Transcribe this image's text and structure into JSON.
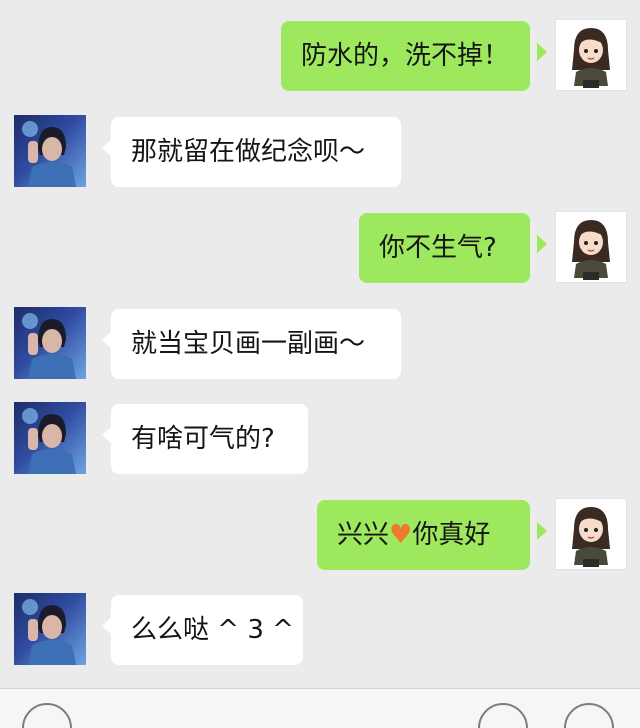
{
  "messages": [
    {
      "side": "out",
      "text": "防水的，洗不掉！"
    },
    {
      "side": "in",
      "text": "那就留在做纪念呗～"
    },
    {
      "side": "out",
      "text": "你不生气?"
    },
    {
      "side": "in",
      "text": "就当宝贝画一副画～"
    },
    {
      "side": "in",
      "text": "有啥可气的?"
    },
    {
      "side": "out",
      "text_before": "兴兴",
      "emoji": "♥",
      "text_after": "你真好"
    },
    {
      "side": "in",
      "text": "么么哒 ^ 3 ^"
    }
  ],
  "colors": {
    "background": "#ebebeb",
    "incoming_bubble": "#ffffff",
    "outgoing_bubble": "#9ee85d",
    "heart": "#f07a2b"
  },
  "icons": {
    "contact_avatar": "young-man-photo-avatar",
    "self_avatar": "cartoon-girl-avatar",
    "input_bar_left": "voice-icon",
    "input_bar_right_1": "emoji-icon",
    "input_bar_right_2": "plus-icon"
  }
}
